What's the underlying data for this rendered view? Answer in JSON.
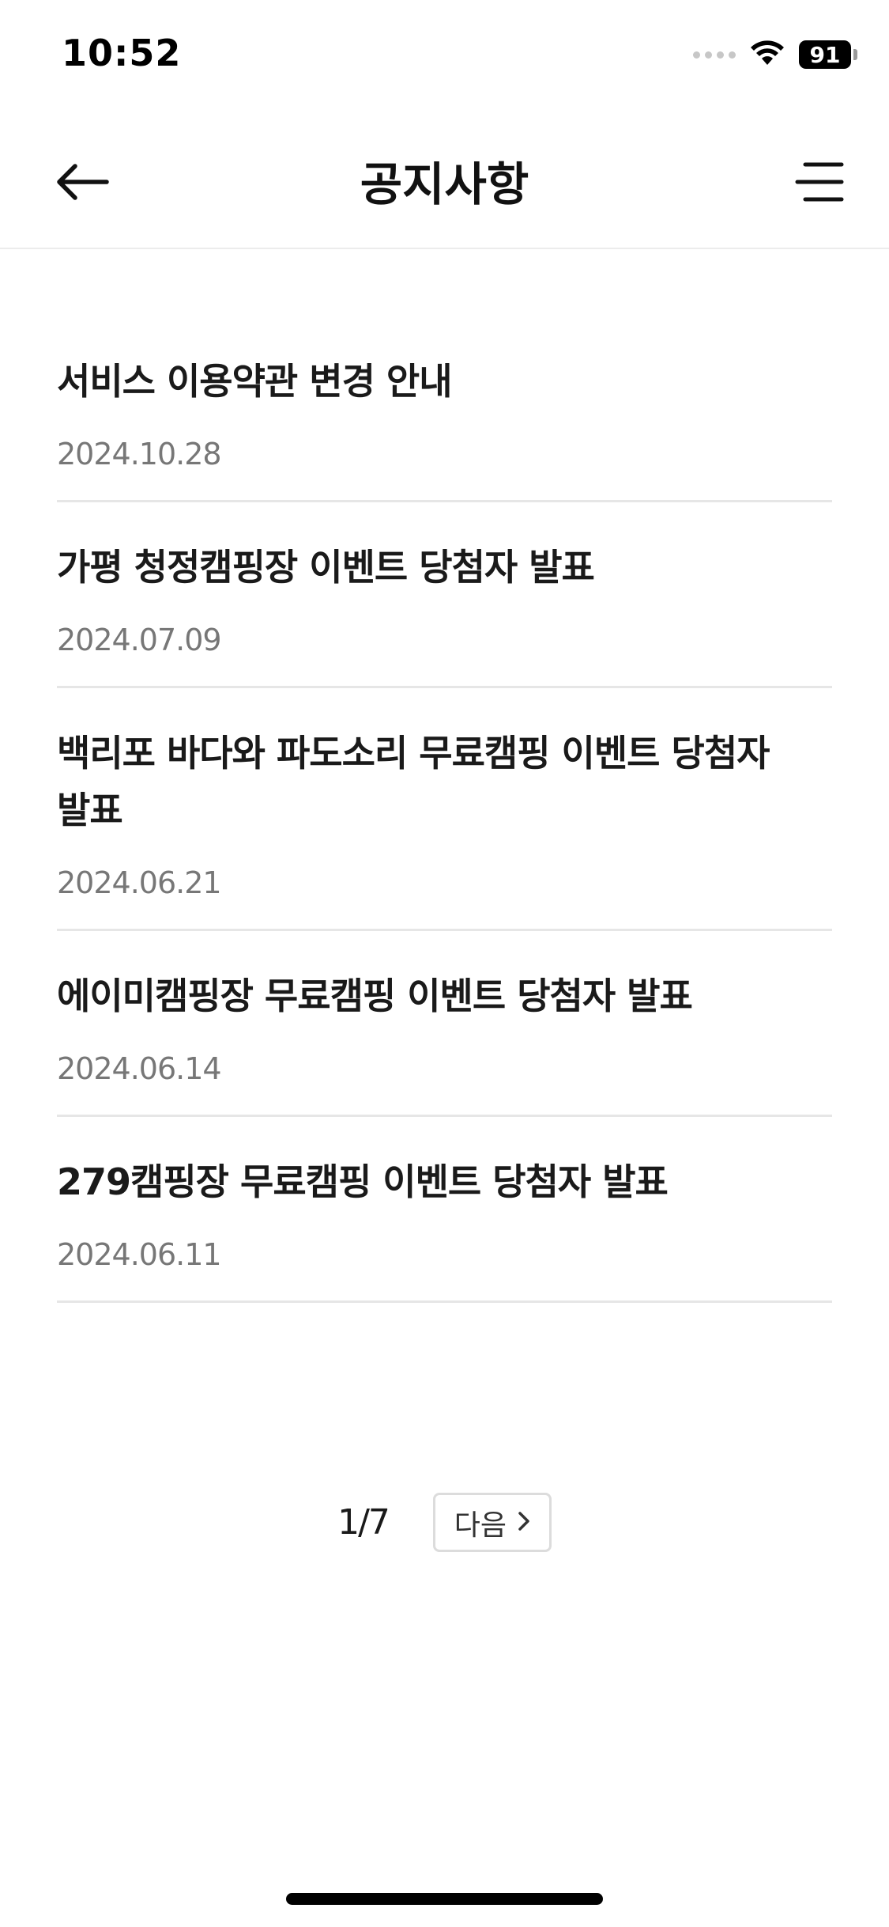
{
  "status_bar": {
    "time": "10:52",
    "battery": "91"
  },
  "header": {
    "title": "공지사항",
    "back_icon": "arrow-left-icon",
    "menu_icon": "menu-icon"
  },
  "notices": [
    {
      "title": "서비스 이용약관 변경 안내",
      "date": "2024.10.28"
    },
    {
      "title": "가평 청정캠핑장 이벤트 당첨자 발표",
      "date": "2024.07.09"
    },
    {
      "title": "백리포 바다와 파도소리 무료캠핑 이벤트 당첨자 발표",
      "date": "2024.06.21"
    },
    {
      "title": "에이미캠핑장 무료캠핑 이벤트 당첨자 발표",
      "date": "2024.06.14"
    },
    {
      "title": "279캠핑장 무료캠핑 이벤트 당첨자 발표",
      "date": "2024.06.11"
    }
  ],
  "pagination": {
    "current": "1/7",
    "next_label": "다음",
    "next_icon": "chevron-right-icon"
  }
}
